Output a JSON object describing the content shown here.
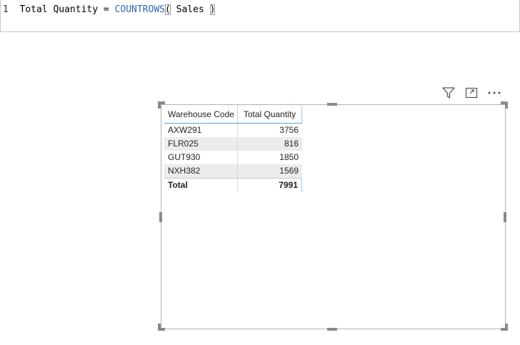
{
  "formula": {
    "line_number": "1",
    "measure_name": "Total Quantity",
    "operator": "=",
    "function": "COUNTROWS",
    "open_paren": "(",
    "argument": "Sales",
    "close_paren": ")"
  },
  "visual_header": {
    "icons": [
      "filter-icon",
      "focus-mode-icon",
      "more-options-icon"
    ]
  },
  "table": {
    "columns": [
      "Warehouse Code",
      "Total Quantity"
    ],
    "rows": [
      {
        "code": "AXW291",
        "qty": "3756"
      },
      {
        "code": "FLR025",
        "qty": "816"
      },
      {
        "code": "GUT930",
        "qty": "1850"
      },
      {
        "code": "NXH382",
        "qty": "1569"
      }
    ],
    "total": {
      "label": "Total",
      "qty": "7991"
    }
  },
  "colors": {
    "function_keyword": "#3166b8",
    "header_underline": "#5ba3d9",
    "row_shade": "#ececec"
  }
}
